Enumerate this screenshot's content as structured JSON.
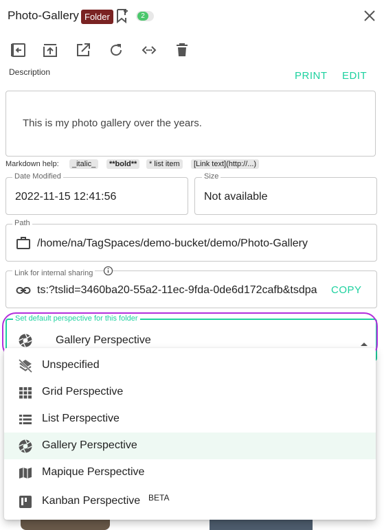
{
  "header": {
    "title": "Photo-Gallery",
    "folder_badge": "Folder",
    "tag_count": "2"
  },
  "toolbar": {
    "icons": [
      "open-parent-icon",
      "open-in-app-icon",
      "open-external-icon",
      "reload-icon",
      "share-link-icon",
      "delete-icon"
    ]
  },
  "description": {
    "label": "Description",
    "print_label": "PRINT",
    "edit_label": "EDIT",
    "text": "This is my photo gallery over the years."
  },
  "markdown_help": {
    "label": "Markdown help:",
    "chips": [
      "_italic_",
      "**bold**",
      "* list item",
      "[Link text](http://...)"
    ]
  },
  "date_modified": {
    "label": "Date Modified",
    "value": "2022-11-15 12:41:56"
  },
  "size": {
    "label": "Size",
    "value": "Not available"
  },
  "path": {
    "label": "Path",
    "value": "/home/na/TagSpaces/demo-bucket/demo/Photo-Gallery"
  },
  "sharing": {
    "label": "Link for internal sharing",
    "value": "ts:?tslid=3460ba20-55a2-11ec-9fda-0de6d172cafb&tsdpa",
    "copy_label": "COPY"
  },
  "perspective": {
    "label": "Set default perspective for this folder",
    "selected": "Gallery Perspective",
    "options": [
      {
        "label": "Unspecified",
        "icon": "layers-off-icon"
      },
      {
        "label": "Grid Perspective",
        "icon": "grid-icon"
      },
      {
        "label": "List Perspective",
        "icon": "list-icon"
      },
      {
        "label": "Gallery Perspective",
        "icon": "camera-iris-icon"
      },
      {
        "label": "Mapique Perspective",
        "icon": "map-icon"
      },
      {
        "label": "Kanban Perspective",
        "icon": "kanban-icon",
        "badge": "BETA"
      }
    ]
  },
  "colors": {
    "accent": "#1dd19f",
    "folder_badge": "#7a2323",
    "highlight_ring": "#b22fdc",
    "selected_row": "#eef9f3"
  }
}
